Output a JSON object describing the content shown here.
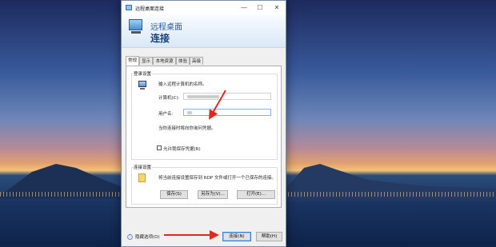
{
  "window": {
    "title": "远程桌面连接",
    "controls": {
      "minimize": "—",
      "maximize": "☐",
      "close": "✕"
    }
  },
  "header": {
    "line1": "远程桌面",
    "line2": "连接"
  },
  "tabs": [
    {
      "label": "常规",
      "active": true
    },
    {
      "label": "显示",
      "active": false
    },
    {
      "label": "本地资源",
      "active": false
    },
    {
      "label": "体验",
      "active": false
    },
    {
      "label": "高级",
      "active": false
    }
  ],
  "login_settings": {
    "title": "登录设置",
    "hint": "输入远程计算机的名称。",
    "computer_label": "计算机(C):",
    "computer_value": "",
    "username_label": "用户名:",
    "username_value": "",
    "note": "当你连接时将向你询问凭据。",
    "save_checkbox_label": "允许我保存凭据(R)",
    "save_checked": false
  },
  "connection_settings": {
    "title": "连接设置",
    "desc": "将当前连接设置保存到 RDP 文件或打开一个已保存的连接。",
    "save": "保存(S)",
    "save_as": "另存为(V)...",
    "open": "打开(E)..."
  },
  "footer": {
    "hide_options": "隐藏选项(O)",
    "connect": "连接(N)",
    "help": "帮助(H)"
  },
  "colors": {
    "accent": "#2c5aa0",
    "arrow": "#e0281e",
    "focus": "#7eb4ea"
  },
  "icons": [
    "remote-desktop-icon",
    "computer-icon",
    "folder-icon",
    "chevron-up-icon"
  ]
}
